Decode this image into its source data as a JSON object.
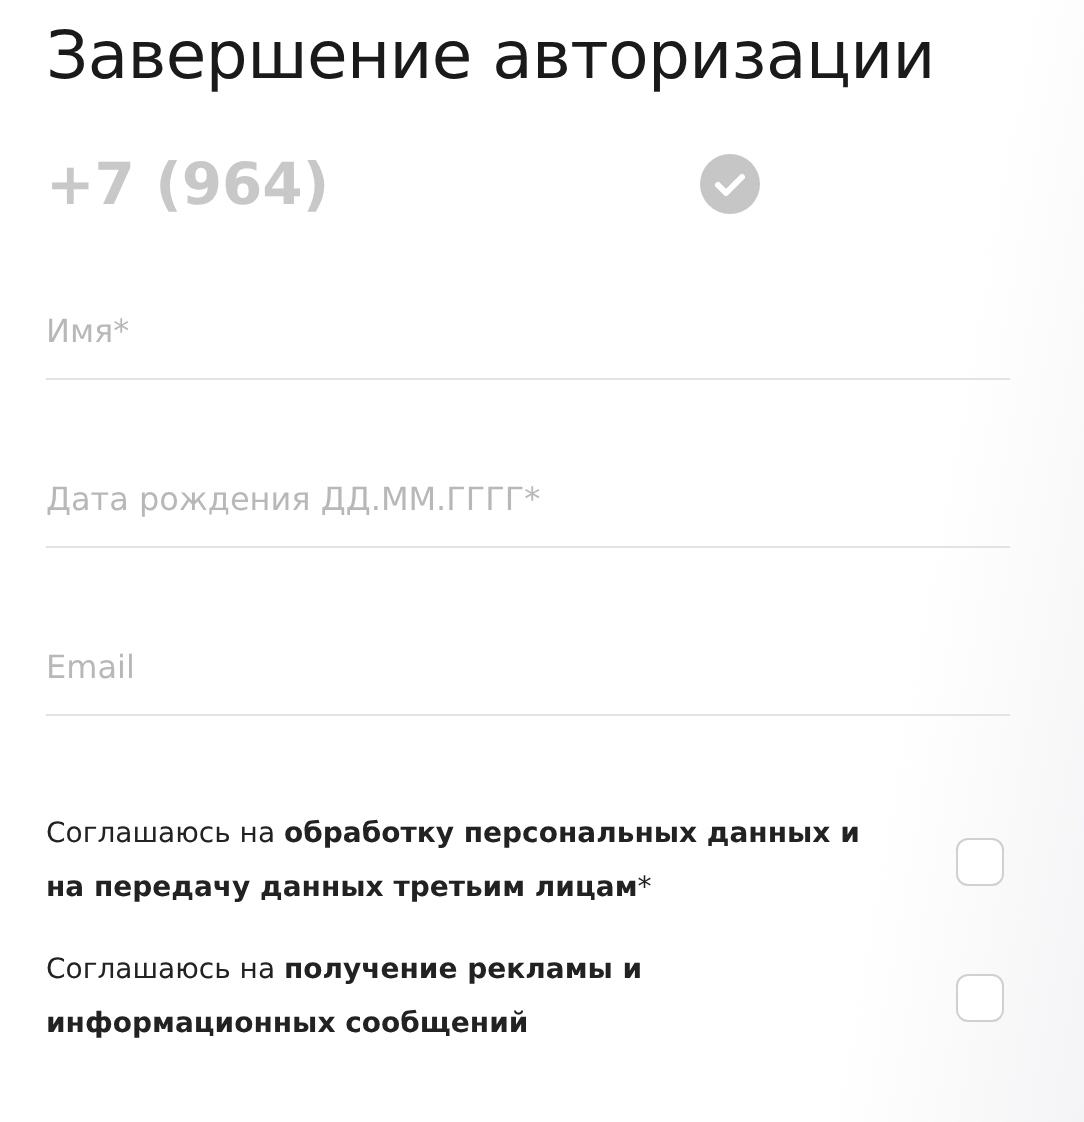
{
  "title": "Завершение авторизации",
  "phone": {
    "value": "+7 (964)"
  },
  "fields": [
    {
      "placeholder": "Имя*"
    },
    {
      "placeholder": "Дата рождения ДД.ММ.ГГГГ*"
    },
    {
      "placeholder": "Email"
    }
  ],
  "consents": [
    {
      "text": "Соглашаюсь на **обработку персональных данных и на передачу данных третьим лицам***",
      "checked": false
    },
    {
      "text": "Соглашаюсь на **получение рекламы и информационных сообщений**",
      "checked": false
    }
  ]
}
